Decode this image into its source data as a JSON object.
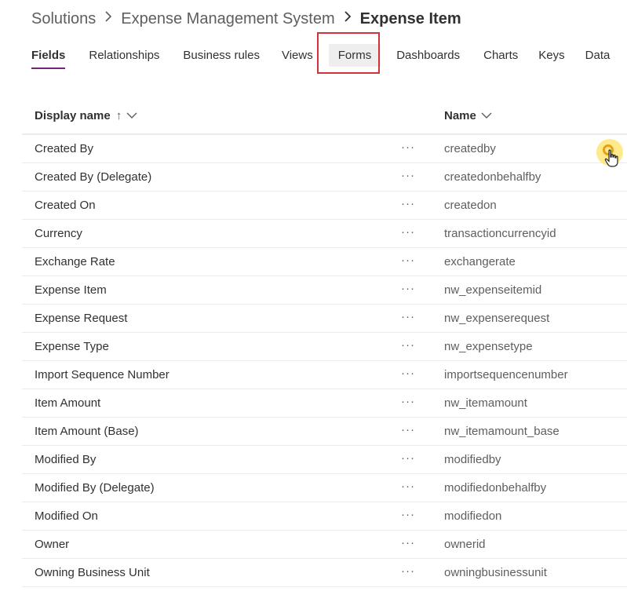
{
  "breadcrumb": {
    "items": [
      "Solutions",
      "Expense Management System"
    ],
    "current": "Expense Item"
  },
  "tabs": [
    "Fields",
    "Relationships",
    "Business rules",
    "Views",
    "Forms",
    "Dashboards",
    "Charts",
    "Keys",
    "Data"
  ],
  "selected_tab": "Fields",
  "highlighted_tab": "Forms",
  "table": {
    "columns": {
      "display_name": "Display name",
      "name": "Name"
    },
    "sort_indicator": "↑",
    "more_label": "···",
    "rows": [
      {
        "display": "Created By",
        "name": "createdby"
      },
      {
        "display": "Created By (Delegate)",
        "name": "createdonbehalfby"
      },
      {
        "display": "Created On",
        "name": "createdon"
      },
      {
        "display": "Currency",
        "name": "transactioncurrencyid"
      },
      {
        "display": "Exchange Rate",
        "name": "exchangerate"
      },
      {
        "display": "Expense Item",
        "name": "nw_expenseitemid"
      },
      {
        "display": "Expense Request",
        "name": "nw_expenserequest"
      },
      {
        "display": "Expense Type",
        "name": "nw_expensetype"
      },
      {
        "display": "Import Sequence Number",
        "name": "importsequencenumber"
      },
      {
        "display": "Item Amount",
        "name": "nw_itemamount"
      },
      {
        "display": "Item Amount (Base)",
        "name": "nw_itemamount_base"
      },
      {
        "display": "Modified By",
        "name": "modifiedby"
      },
      {
        "display": "Modified By (Delegate)",
        "name": "modifiedonbehalfby"
      },
      {
        "display": "Modified On",
        "name": "modifiedon"
      },
      {
        "display": "Owner",
        "name": "ownerid"
      },
      {
        "display": "Owning Business Unit",
        "name": "owningbusinessunit"
      }
    ]
  },
  "colors": {
    "accent": "#742774",
    "highlight_border": "#d13438",
    "cursor_halo": "#ffe15a"
  },
  "icons": {
    "separator": "chevron-right-icon",
    "column_menu": "chevron-down-icon",
    "cursor": "hand-pointer-icon"
  }
}
